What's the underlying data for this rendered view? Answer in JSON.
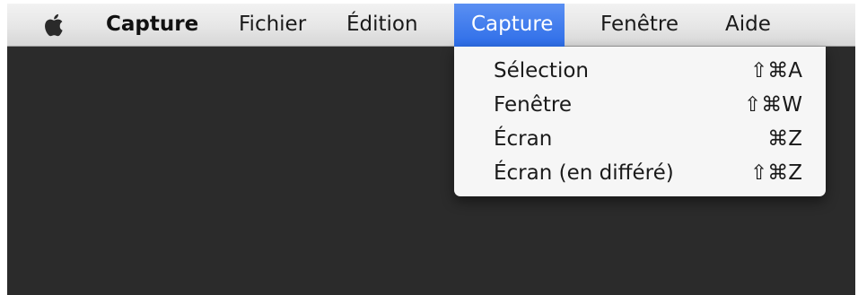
{
  "menubar": {
    "app_name": "Capture",
    "items": [
      "Fichier",
      "Édition",
      "Capture",
      "Fenêtre",
      "Aide"
    ],
    "active_item": "Capture",
    "active_color": "#3a7bef",
    "apple_icon": "apple-logo-icon"
  },
  "capture_menu": {
    "items": [
      {
        "label": "Sélection",
        "shortcut": "⇧⌘A"
      },
      {
        "label": "Fenêtre",
        "shortcut": "⇧⌘W"
      },
      {
        "label": "Écran",
        "shortcut": "⌘Z"
      },
      {
        "label": "Écran (en différé)",
        "shortcut": "⇧⌘Z"
      }
    ]
  }
}
